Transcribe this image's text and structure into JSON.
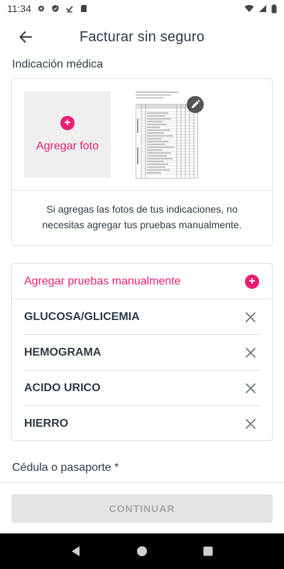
{
  "status_bar": {
    "time": "11:34"
  },
  "app_bar": {
    "title": "Facturar sin seguro",
    "back_icon": "arrow-left-icon"
  },
  "indication": {
    "label": "Indicación médica",
    "add_photo_label": "Agregar foto",
    "info_text": "Si agregas las fotos de tus indicaciones, no necesitas agregar tus pruebas manualmente."
  },
  "tests": {
    "add_manual_label": "Agregar pruebas manualmente",
    "items": [
      {
        "name": "GLUCOSA/GLICEMIA"
      },
      {
        "name": "HEMOGRAMA"
      },
      {
        "name": "ACIDO URICO"
      },
      {
        "name": "HIERRO"
      }
    ]
  },
  "id_field": {
    "label": "Cédula o pasaporte *"
  },
  "footer": {
    "continue_label": "CONTINUAR"
  },
  "colors": {
    "accent": "#e91e73",
    "text": "#2e3b45",
    "border": "#dcdfe3",
    "disabled_bg": "#e2e3e4",
    "disabled_text": "#a4a8ab"
  }
}
